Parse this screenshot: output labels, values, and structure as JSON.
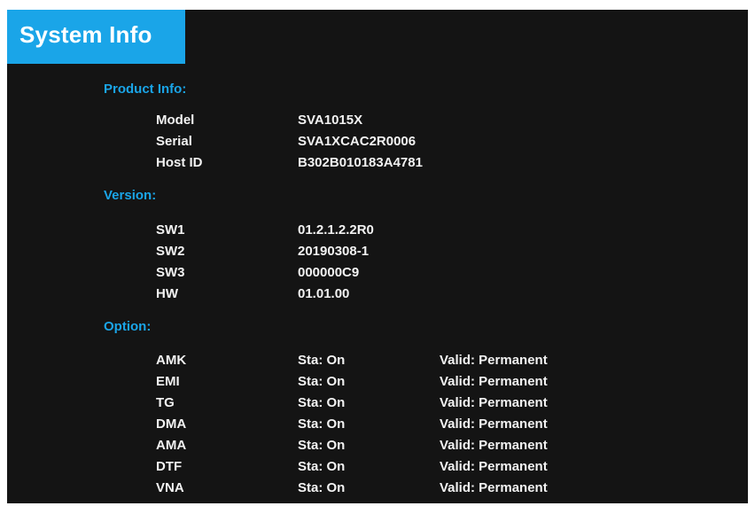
{
  "window": {
    "title": "System Info"
  },
  "product_info": {
    "heading": "Product Info:",
    "rows": [
      {
        "label": "Model",
        "value": "SVA1015X"
      },
      {
        "label": "Serial",
        "value": "SVA1XCAC2R0006"
      },
      {
        "label": "Host ID",
        "value": "B302B010183A4781"
      }
    ]
  },
  "version": {
    "heading": "Version:",
    "rows": [
      {
        "label": "SW1",
        "value": "01.2.1.2.2R0"
      },
      {
        "label": "SW2",
        "value": "20190308-1"
      },
      {
        "label": "SW3",
        "value": "000000C9"
      },
      {
        "label": "HW",
        "value": "01.01.00"
      }
    ]
  },
  "option": {
    "heading": "Option:",
    "rows": [
      {
        "name": "AMK",
        "status": "Sta: On",
        "validity": "Valid: Permanent"
      },
      {
        "name": "EMI",
        "status": "Sta: On",
        "validity": "Valid: Permanent"
      },
      {
        "name": "TG",
        "status": "Sta: On",
        "validity": "Valid: Permanent"
      },
      {
        "name": "DMA",
        "status": "Sta: On",
        "validity": "Valid: Permanent"
      },
      {
        "name": "AMA",
        "status": "Sta: On",
        "validity": "Valid: Permanent"
      },
      {
        "name": "DTF",
        "status": "Sta: On",
        "validity": "Valid: Permanent"
      },
      {
        "name": "VNA",
        "status": "Sta: On",
        "validity": "Valid: Permanent"
      }
    ]
  },
  "colors": {
    "accent": "#1aa5e8",
    "background": "#141414",
    "text": "#f2f2f2"
  }
}
